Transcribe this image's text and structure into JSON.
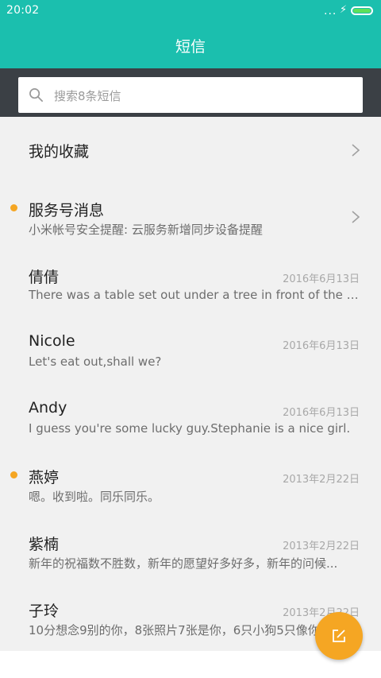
{
  "status_bar": {
    "time": "20:02",
    "signal": "...",
    "charging": "⚡",
    "icons": [
      "signal-dots-icon",
      "charging-bolt-icon",
      "battery-icon"
    ]
  },
  "header": {
    "title": "短信"
  },
  "search": {
    "placeholder": "搜索8条短信",
    "icon": "search-icon"
  },
  "list": {
    "favorites": {
      "label": "我的收藏",
      "icon": "chevron-right-icon"
    },
    "service": {
      "name": "服务号消息",
      "preview": "小米帐号安全提醒: 云服务新增同步设备提醒",
      "unread": true,
      "icon": "chevron-right-icon"
    },
    "conversations": [
      {
        "name": "倩倩",
        "preview": "There was a table set out under a tree in front of the house...",
        "date": "2016年6月13日",
        "unread": false
      },
      {
        "name": "Nicole",
        "preview": "Let's eat out,shall we?",
        "date": "2016年6月13日",
        "unread": false
      },
      {
        "name": "Andy",
        "preview": "I guess you're some lucky guy.Stephanie is a nice girl.",
        "date": "2016年6月13日",
        "unread": false
      },
      {
        "name": "燕婷",
        "preview": "嗯。收到啦。同乐同乐。",
        "date": "2013年2月22日",
        "unread": true
      },
      {
        "name": "紫楠",
        "preview": "新年的祝福数不胜数，新年的愿望好多好多，新年的问候...",
        "date": "2013年2月22日",
        "unread": false
      },
      {
        "name": "子玲",
        "preview": "10分想念9别的你，8张照片7张是你，6只小狗5只像你",
        "date": "2013年2月22日",
        "unread": false
      }
    ]
  },
  "fab": {
    "icon": "compose-icon"
  },
  "colors": {
    "accent": "#1bbfae",
    "unread_dot": "#f5a623",
    "fab": "#f5a623",
    "search_bar_bg": "#3b4045",
    "list_bg": "#f1f1f1"
  }
}
